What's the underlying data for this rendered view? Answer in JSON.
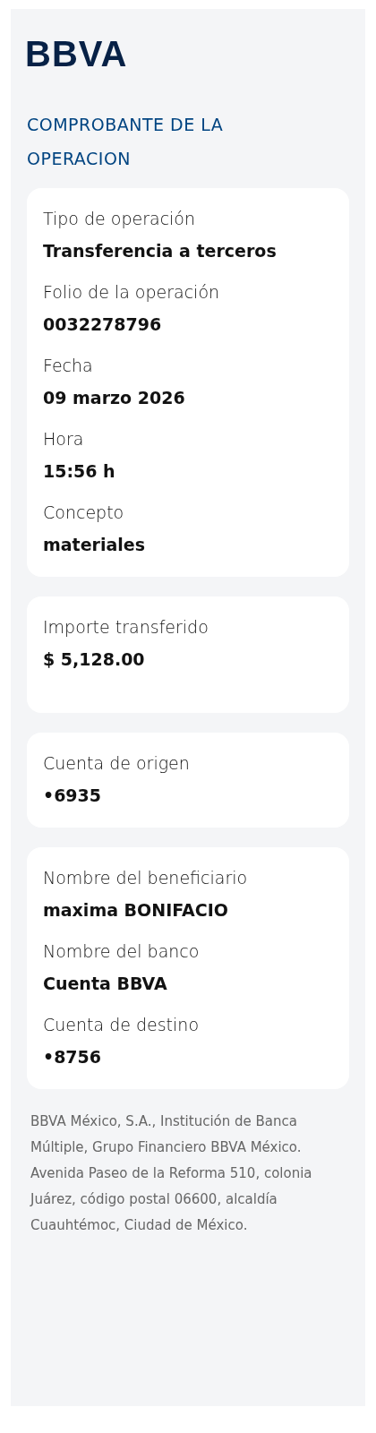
{
  "logo": "BBVA",
  "title": "COMPROBANTE DE LA OPERACION",
  "cards": [
    {
      "fields": [
        {
          "label": "Tipo de operación",
          "value": "Transferencia a terceros"
        },
        {
          "label": "Folio de la operación",
          "value": "0032278796"
        },
        {
          "label": "Fecha",
          "value": "09 marzo 2026"
        },
        {
          "label": "Hora",
          "value": "15:56 h"
        },
        {
          "label": "Concepto",
          "value": "materiales"
        }
      ]
    },
    {
      "fields": [
        {
          "label": "Importe transferido",
          "value": "$ 5,128.00"
        }
      ]
    },
    {
      "fields": [
        {
          "label": "Cuenta de origen",
          "value": "•6935"
        }
      ]
    },
    {
      "fields": [
        {
          "label": "Nombre del beneficiario",
          "value": "maxima BONIFACIO"
        },
        {
          "label": "Nombre del banco",
          "value": "Cuenta BBVA"
        },
        {
          "label": "Cuenta de destino",
          "value": "•8756"
        }
      ]
    }
  ],
  "footer": "BBVA México, S.A., Institución de Banca Múltiple, Grupo Financiero BBVA México. Avenida Paseo de la Reforma 510, colonia Juárez, código postal 06600, alcaldía Cuauhtémoc, Ciudad de México."
}
